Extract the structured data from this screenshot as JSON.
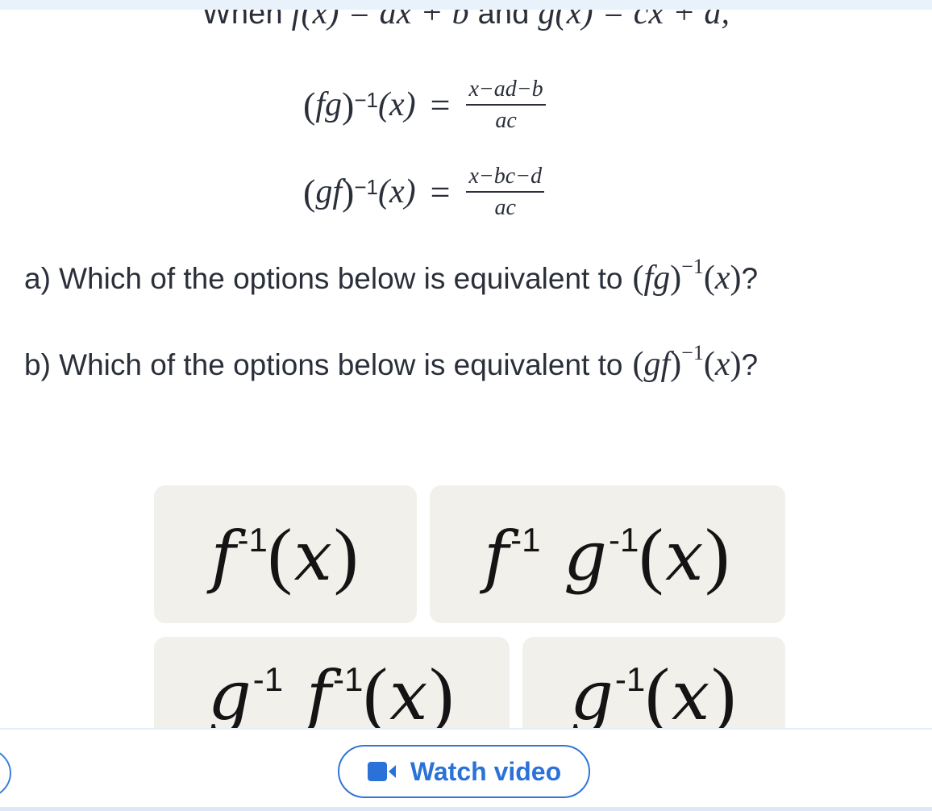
{
  "intro": {
    "prefix": "When",
    "f_def": "f(x) = ax + b",
    "and": "and",
    "g_def": "g(x) = cx + d,"
  },
  "formulas": [
    {
      "lhs": "fg",
      "exp": "−1",
      "arg": "(x)",
      "eq": "=",
      "numerator": "x−ad−b",
      "denominator": "ac"
    },
    {
      "lhs": "gf",
      "exp": "−1",
      "arg": "(x)",
      "eq": "=",
      "numerator": "x−bc−d",
      "denominator": "ac"
    }
  ],
  "questions": [
    {
      "text": "a) Which of the options below is equivalent to",
      "expr": "fg",
      "exp": "−1",
      "arg": "x",
      "end": "?"
    },
    {
      "text": "b) Which of the options below is equivalent to",
      "expr": "gf",
      "exp": "−1",
      "arg": "x",
      "end": "?"
    }
  ],
  "options": [
    {
      "terms": [
        {
          "fn": "f",
          "exp": "-1"
        }
      ],
      "arg": "x"
    },
    {
      "terms": [
        {
          "fn": "f",
          "exp": "-1"
        },
        {
          "fn": "g",
          "exp": "-1"
        }
      ],
      "arg": "x"
    },
    {
      "terms": [
        {
          "fn": "g",
          "exp": "-1"
        },
        {
          "fn": "f",
          "exp": "-1"
        }
      ],
      "arg": "x"
    },
    {
      "terms": [
        {
          "fn": "g",
          "exp": "-1"
        }
      ],
      "arg": "x"
    }
  ],
  "footer": {
    "watch_video_label": "Watch video",
    "watch_video_icon": "video-camera-icon"
  },
  "colors": {
    "accent": "#2a72d8",
    "card_bg": "#f2f0eb",
    "text": "#2a2f3a",
    "top_band": "#e9f1fb"
  }
}
